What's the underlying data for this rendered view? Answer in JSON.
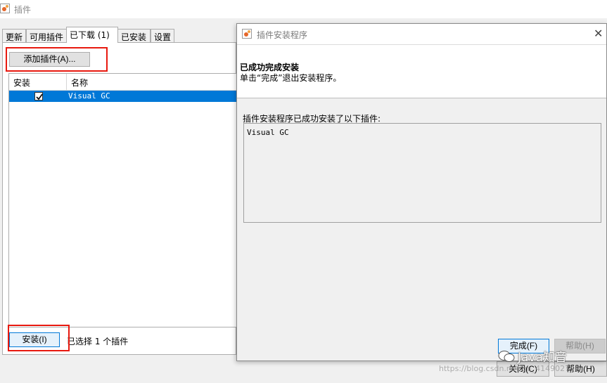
{
  "main_window": {
    "title": "插件",
    "tabs": [
      {
        "label": "更新",
        "active": false
      },
      {
        "label": "可用插件",
        "active": false
      },
      {
        "label": "已下载 (1)",
        "active": true
      },
      {
        "label": "已安装",
        "active": false
      },
      {
        "label": "设置",
        "active": false
      }
    ],
    "add_plugin_label": "添加插件(A)...",
    "table": {
      "columns": [
        "安装",
        "名称"
      ],
      "rows": [
        {
          "installed": true,
          "name": "Visual GC"
        }
      ]
    },
    "install_label": "安装(I)",
    "selected_status": "已选择 1 个插件",
    "close_label": "关闭(C)",
    "help_label": "帮助(H)"
  },
  "installer_dialog": {
    "title": "插件安装程序",
    "header_title": "已成功完成安装",
    "header_subtitle": "单击“完成”退出安装程序。",
    "installed_label": "插件安装程序已成功安装了以下插件:",
    "installed_plugins": [
      "Visual GC"
    ],
    "finish_label": "完成(F)",
    "help_label": "帮助(H)"
  },
  "watermark": {
    "brand": "Java知音",
    "url": "https://blog.csdn.net/qq_41490274"
  },
  "colors": {
    "selection": "#0078d7",
    "highlight_box": "#e8190f",
    "window_bg": "#f0f0f0"
  },
  "icons": [
    "app-icon",
    "checkbox-checked-icon",
    "close-icon",
    "wechat-icon"
  ]
}
